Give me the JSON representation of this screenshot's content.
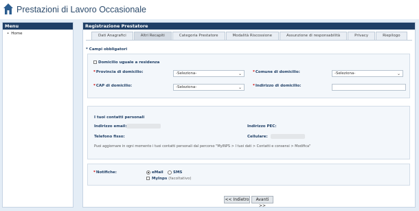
{
  "app": {
    "title": "Prestazioni di Lavoro Occasionale",
    "logo_icon": "home-icon"
  },
  "sidebar": {
    "title": "Menu",
    "items": [
      {
        "label": "Home"
      }
    ]
  },
  "main": {
    "title": "Registrazione Prestatore",
    "tabs": [
      {
        "label": "Dati Anagrafici",
        "active": false
      },
      {
        "label": "Altri Recapiti",
        "active": true
      },
      {
        "label": "Categoria Prestatore",
        "active": false
      },
      {
        "label": "Modalità Riscossione",
        "active": false
      },
      {
        "label": "Assunzione di responsabilità",
        "active": false
      },
      {
        "label": "Privacy",
        "active": false
      },
      {
        "label": "Riepilogo",
        "active": false
      }
    ],
    "required_note": "* Campi obbligatori"
  },
  "address": {
    "same_domicile_label": "Domicilio uguale a residenza",
    "province_label": "Provincia di domicilio:",
    "province_value": "-Seleziona-",
    "comune_label": "Comune di domicilio:",
    "comune_value": "-Seleziona-",
    "cap_label": "CAP di domicilio:",
    "cap_value": "-Seleziona-",
    "indirizzo_label": "Indirizzo di domicilio:",
    "indirizzo_value": ""
  },
  "contacts": {
    "title": "I tuoi contatti personali",
    "email_label": "Indirizzo email:",
    "pec_label": "Indirizzo PEC:",
    "phone_label": "Telefono fisso:",
    "mobile_label": "Cellulare:",
    "note": "Puoi aggiornare in ogni momento i tuoi contatti personali dal percorso \"MyINPS > I tuoi dati > Contatti e consensi > Modifica\""
  },
  "notifications": {
    "label": "Notifiche:",
    "email_option": "eMail",
    "sms_option": "SMS",
    "myinps_option": "MyInps",
    "myinps_suffix": "(facoltativo)",
    "selected": "eMail"
  },
  "nav": {
    "back_label": "<< Indietro",
    "next_label": "Avanti >>"
  }
}
